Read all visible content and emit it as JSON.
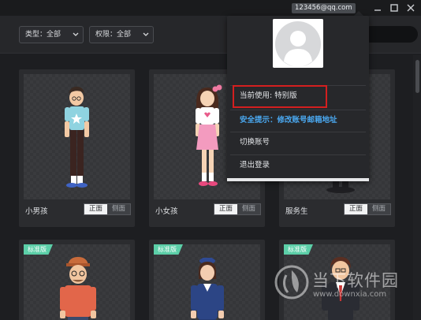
{
  "titlebar": {
    "account": "123456@qq.com"
  },
  "filters": {
    "type_label": "类型：全部",
    "permission_label": "权限：全部"
  },
  "characters": [
    {
      "name": "小男孩",
      "front": "正面",
      "side": "侧面",
      "badge": ""
    },
    {
      "name": "小女孩",
      "front": "正面",
      "side": "侧面",
      "badge": ""
    },
    {
      "name": "服务生",
      "front": "正面",
      "side": "侧面",
      "badge": ""
    },
    {
      "name": "",
      "front": "",
      "side": "",
      "badge": "标准版"
    },
    {
      "name": "",
      "front": "",
      "side": "",
      "badge": "标准版"
    },
    {
      "name": "",
      "front": "",
      "side": "",
      "badge": "标准版"
    }
  ],
  "account_menu": {
    "current_plan": "当前使用: 特别版",
    "security_tip": "安全提示：修改账号邮箱地址",
    "switch_account": "切换账号",
    "logout": "退出登录"
  },
  "watermark": {
    "brand": "当下软件园",
    "url": "www.downxia.com"
  },
  "colors": {
    "background": "#1d1e21",
    "card": "#2b2c2f",
    "badge": "#5ccfa8",
    "link": "#4aa8f0",
    "highlight_border": "#d41f1f"
  },
  "icons": [
    "chevron-down-icon",
    "minimize-icon",
    "maximize-icon",
    "close-icon",
    "avatar-placeholder-icon"
  ]
}
